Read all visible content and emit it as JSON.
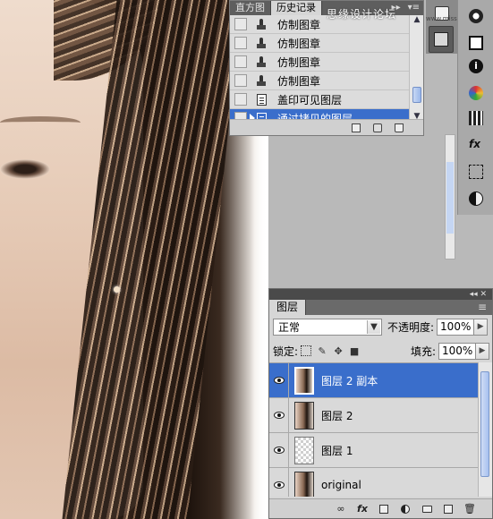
{
  "history_panel": {
    "tabs": [
      {
        "label": "直方图",
        "active": false
      },
      {
        "label": "历史记录",
        "active": true
      }
    ],
    "items": [
      {
        "label": "仿制图章",
        "icon": "clone-stamp-icon",
        "selected": false
      },
      {
        "label": "仿制图章",
        "icon": "clone-stamp-icon",
        "selected": false
      },
      {
        "label": "仿制图章",
        "icon": "clone-stamp-icon",
        "selected": false
      },
      {
        "label": "仿制图章",
        "icon": "clone-stamp-icon",
        "selected": false
      },
      {
        "label": "盖印可见图层",
        "icon": "document-icon",
        "selected": false
      },
      {
        "label": "通过拷贝的图层",
        "icon": "document-icon",
        "selected": true
      }
    ]
  },
  "watermark": {
    "text": "思缘设计论坛",
    "sub": "www.missyuan.com"
  },
  "layers_panel": {
    "tab": "图层",
    "blend_mode": "正常",
    "opacity_label": "不透明度:",
    "opacity_value": "100%",
    "lock_label": "锁定:",
    "fill_label": "填充:",
    "fill_value": "100%",
    "layers": [
      {
        "name": "图层 2 副本",
        "thumbnail": "photo",
        "visible": true,
        "selected": true
      },
      {
        "name": "图层 2",
        "thumbnail": "photo",
        "visible": true,
        "selected": false
      },
      {
        "name": "图层 1",
        "thumbnail": "transparent",
        "visible": true,
        "selected": false
      },
      {
        "name": "original",
        "thumbnail": "photo",
        "visible": true,
        "selected": false
      }
    ],
    "footer_icons": [
      "link-icon",
      "fx-icon",
      "mask-icon",
      "adjustment-icon",
      "group-folder-icon",
      "new-layer-icon",
      "trash-icon"
    ]
  },
  "dock_icons": [
    "navigator-icon",
    "info-icon",
    "color-icon",
    "swatches-icon",
    "styles-icon",
    "transform-icon",
    "masks-icon"
  ],
  "colors": {
    "selection": "#3a6ecb",
    "panel_bg": "#d6d6d6",
    "tab_bar": "#5e5e5e"
  }
}
